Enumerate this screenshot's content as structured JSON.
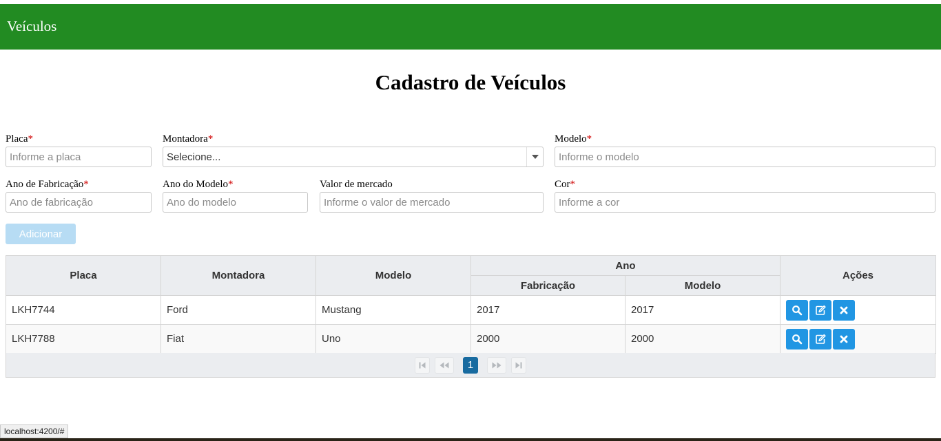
{
  "navbar": {
    "brand": "Veículos"
  },
  "page": {
    "title": "Cadastro de Veículos"
  },
  "form": {
    "placa": {
      "label": "Placa",
      "placeholder": "Informe a placa",
      "required": true
    },
    "montadora": {
      "label": "Montadora",
      "selected": "Selecione...",
      "required": true
    },
    "modelo": {
      "label": "Modelo",
      "placeholder": "Informe o modelo",
      "required": true
    },
    "ano_fabricacao": {
      "label": "Ano de Fabricação",
      "placeholder": "Ano de fabricação",
      "required": true
    },
    "ano_modelo": {
      "label": "Ano do Modelo",
      "placeholder": "Ano do modelo",
      "required": true
    },
    "valor_mercado": {
      "label": "Valor de mercado",
      "placeholder": "Informe o valor de mercado",
      "required": false
    },
    "cor": {
      "label": "Cor",
      "placeholder": "Informe a cor",
      "required": true
    },
    "required_mark": "*",
    "add_button": "Adicionar"
  },
  "table": {
    "headers": {
      "placa": "Placa",
      "montadora": "Montadora",
      "modelo": "Modelo",
      "ano": "Ano",
      "fabricacao": "Fabricação",
      "ano_modelo": "Modelo",
      "acoes": "Ações"
    },
    "rows": [
      {
        "placa": "LKH7744",
        "montadora": "Ford",
        "modelo": "Mustang",
        "fabricacao": "2017",
        "ano_modelo": "2017"
      },
      {
        "placa": "LKH7788",
        "montadora": "Fiat",
        "modelo": "Uno",
        "fabricacao": "2000",
        "ano_modelo": "2000"
      }
    ],
    "row_actions": [
      "search-icon",
      "edit-icon",
      "delete-icon"
    ]
  },
  "paginator": {
    "current_page": "1"
  },
  "status_bar": {
    "url": "localhost:4200/#"
  },
  "colors": {
    "navbar": "#228b22",
    "action_button": "#2196e3",
    "add_button_disabled": "#b7dcf4",
    "active_page": "#186ba0",
    "required": "#d00000"
  }
}
